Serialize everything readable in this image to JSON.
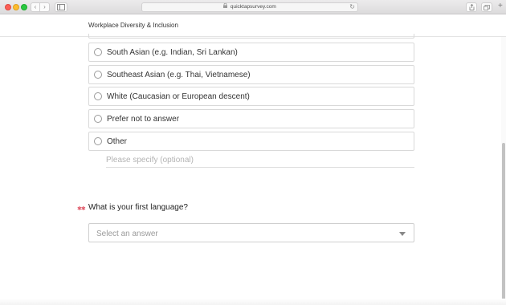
{
  "browser": {
    "url": "quicktapsurvey.com",
    "lock_icon": "lock-icon",
    "back_glyph": "‹",
    "forward_glyph": "›",
    "reload_glyph": "↻",
    "new_tab_glyph": "+"
  },
  "survey": {
    "title": "Workplace Diversity & Inclusion"
  },
  "ethnicity_question": {
    "options": [
      {
        "label": "South Asian (e.g. Indian, Sri Lankan)"
      },
      {
        "label": "Southeast Asian (e.g. Thai, Vietnamese)"
      },
      {
        "label": "White (Caucasian or European descent)"
      },
      {
        "label": "Prefer not to answer"
      },
      {
        "label": "Other"
      }
    ],
    "specify_placeholder": "Please specify (optional)",
    "specify_value": ""
  },
  "language_question": {
    "required_marker": "✱✱",
    "text": "What is your first language?",
    "select_placeholder": "Select an answer"
  },
  "colors": {
    "required": "#e05a6a",
    "border": "#d9d9d9",
    "text": "#333333",
    "placeholder": "#9a9a9a"
  }
}
